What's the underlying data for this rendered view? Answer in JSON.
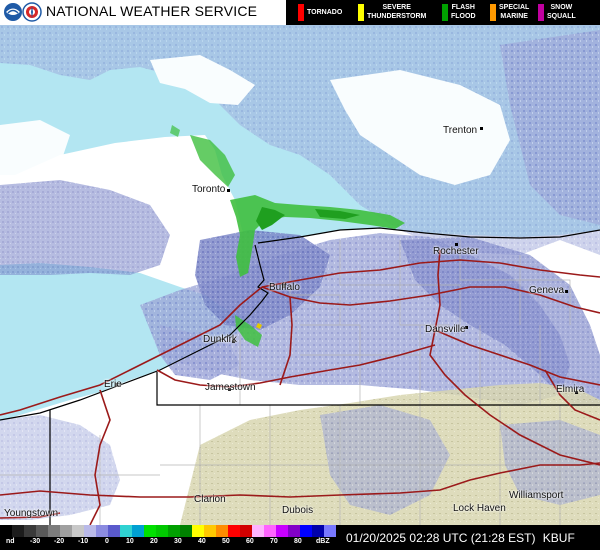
{
  "header": {
    "title": "NATIONAL WEATHER SERVICE",
    "logos": [
      "noaa-logo",
      "nws-logo"
    ],
    "warnings": [
      {
        "label": "TORNADO",
        "color": "#ff0000"
      },
      {
        "label": "SEVERE\nTHUNDERSTORM",
        "color": "#ffff00"
      },
      {
        "label": "FLASH\nFLOOD",
        "color": "#00a000"
      },
      {
        "label": "SPECIAL\nMARINE",
        "color": "#ff9900"
      },
      {
        "label": "SNOW\nSQUALL",
        "color": "#c000a0"
      }
    ]
  },
  "map": {
    "cities": [
      "Trenton",
      "Toronto",
      "Rochester",
      "Buffalo",
      "Geneva",
      "Dansville",
      "Dunkirk",
      "Erie",
      "Jamestown",
      "Elmira",
      "Youngstown",
      "Clarion",
      "Dubois",
      "Williamsport",
      "Lock Haven"
    ],
    "colors": {
      "water": "#b3e6f2",
      "land": "#ffffff",
      "light_echo": "#9ea7d9",
      "echo": "#6d7ac4",
      "green": "#2fbf2f",
      "snow_beige": "#d9d6b0",
      "roads": "#9b1a1a",
      "borders": "#000000",
      "county": "#b5b5b5"
    }
  },
  "legend": {
    "labels": [
      "nd",
      "-30",
      "-20",
      "-10",
      "0",
      "10",
      "20",
      "30",
      "40",
      "50",
      "60",
      "70",
      "80",
      "dBZ"
    ],
    "colors": [
      "#000000",
      "#1c1c1c",
      "#3a3a3a",
      "#5a5a5a",
      "#7c7c7c",
      "#a0a0a0",
      "#c8c8c8",
      "#b9b9e8",
      "#8b8be0",
      "#5a5acc",
      "#2fd2d2",
      "#00a0d2",
      "#00e000",
      "#00c800",
      "#00a000",
      "#008000",
      "#ffff00",
      "#ffc800",
      "#ff8c00",
      "#ff0000",
      "#d20000",
      "#ffb4ff",
      "#ff64ff",
      "#c800ff",
      "#8200c8",
      "#0000ff",
      "#0000aa",
      "#7878ff"
    ]
  },
  "status": {
    "timestamp": "01/20/2025 02:28 UTC (21:28 EST)",
    "radar": "KBUF"
  }
}
